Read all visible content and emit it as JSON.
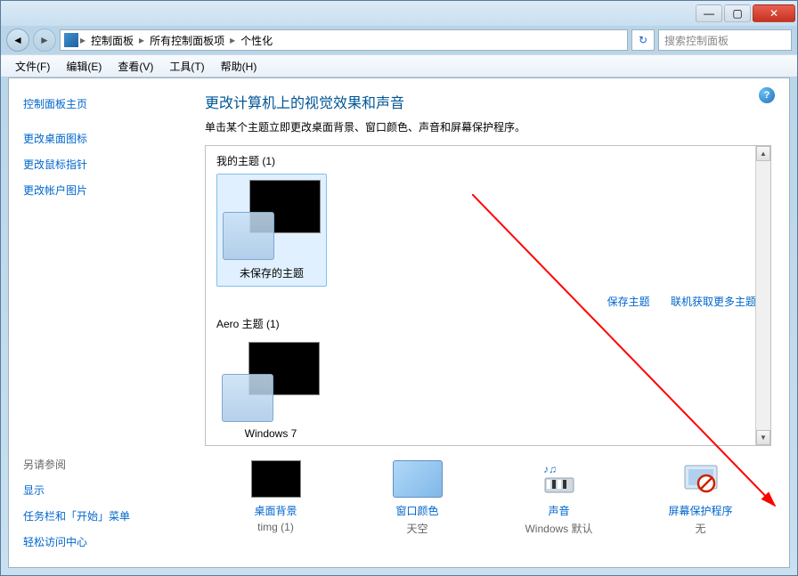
{
  "titlebar": {
    "min": "—",
    "max": "▢",
    "close": "✕"
  },
  "breadcrumb": {
    "seg1": "控制面板",
    "seg2": "所有控制面板项",
    "seg3": "个性化",
    "sep": "▸"
  },
  "search": {
    "placeholder": "搜索控制面板"
  },
  "menubar": [
    {
      "label": "文件(F)"
    },
    {
      "label": "编辑(E)"
    },
    {
      "label": "查看(V)"
    },
    {
      "label": "工具(T)"
    },
    {
      "label": "帮助(H)"
    }
  ],
  "sidebar": {
    "home": "控制面板主页",
    "links": [
      "更改桌面图标",
      "更改鼠标指针",
      "更改帐户图片"
    ],
    "also_title": "另请参阅",
    "also": [
      "显示",
      "任务栏和「开始」菜单",
      "轻松访问中心"
    ]
  },
  "main": {
    "title": "更改计算机上的视觉效果和声音",
    "subtitle": "单击某个主题立即更改桌面背景、窗口颜色、声音和屏幕保护程序。",
    "my_themes": "我的主题 (1)",
    "unsaved": "未保存的主题",
    "save_link": "保存主题",
    "online_link": "联机获取更多主题",
    "aero_themes": "Aero 主题 (1)",
    "windows7": "Windows 7"
  },
  "bottom": [
    {
      "title": "桌面背景",
      "value": "timg (1)"
    },
    {
      "title": "窗口颜色",
      "value": "天空"
    },
    {
      "title": "声音",
      "value": "Windows 默认"
    },
    {
      "title": "屏幕保护程序",
      "value": "无"
    }
  ],
  "help": "?"
}
